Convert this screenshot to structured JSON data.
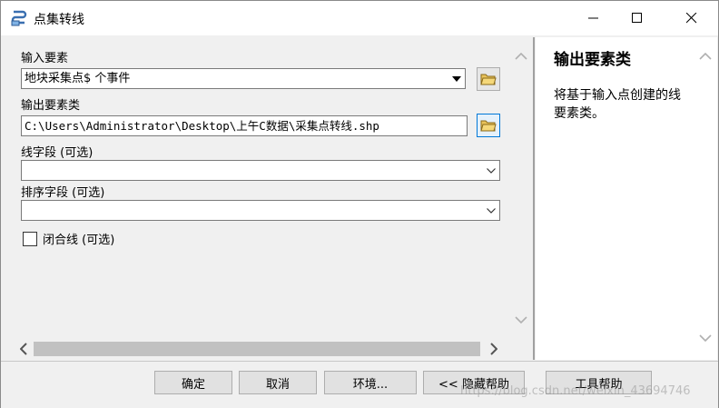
{
  "window": {
    "title": "点集转线",
    "icon": "toolbox-script-icon"
  },
  "form": {
    "input_features_label": "输入要素",
    "input_features_value": "地块采集点$ 个事件",
    "output_fc_label": "输出要素类",
    "output_fc_value": "C:\\Users\\Administrator\\Desktop\\上午C数据\\采集点转线.shp",
    "line_field_label": "线字段 (可选)",
    "line_field_value": "",
    "sort_field_label": "排序字段 (可选)",
    "sort_field_value": "",
    "close_line_label": "闭合线 (可选)",
    "close_line_checked": false
  },
  "help": {
    "title": "输出要素类",
    "text": "将基于输入点创建的线要素类。"
  },
  "buttons": {
    "ok": "确定",
    "cancel": "取消",
    "environments": "环境...",
    "hide_help": "<< 隐藏帮助",
    "tool_help": "工具帮助"
  },
  "watermark": "https://blog.csdn.net/weixin_43694746"
}
